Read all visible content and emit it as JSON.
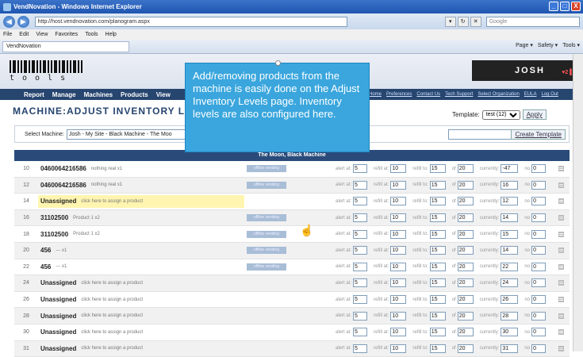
{
  "window": {
    "title": "VendNovation - Windows Internet Explorer",
    "controls": [
      "_",
      "□",
      "X"
    ]
  },
  "browser": {
    "url": "http://host.vendnovation.com/planogram.aspx",
    "search_placeholder": "Google",
    "menu": [
      "File",
      "Edit",
      "View",
      "Favorites",
      "Tools",
      "Help"
    ],
    "tab_label": "VendNovation",
    "toolbar": [
      "Page ▾",
      "Safety ▾",
      "Tools ▾"
    ]
  },
  "site": {
    "logo_text": "tools",
    "user": "JOSH",
    "badge": "♥2 ▌18",
    "nav": [
      "Report",
      "Manage",
      "Machines",
      "Products",
      "View"
    ],
    "top_links": [
      "Home",
      "Preferences",
      "Contact Us",
      "Tech Support",
      "Select Organization",
      "EULA",
      "Log Out"
    ]
  },
  "page": {
    "title": "MACHINE:ADJUST INVENTORY LEVE",
    "template_label": "Template:",
    "template_value": "test (12)",
    "apply_label": "Apply",
    "select_machine_label": "Select Machine:",
    "machine_value": "Josh - My Site - Black Machine - The Moo",
    "create_template_label": "Create Template",
    "table_title": "The Moon, Black Machine"
  },
  "field_labels": {
    "alert": "alert at:",
    "refill": "refill at:",
    "refill_to": "refill to:",
    "of": "of",
    "currently": "currently:",
    "no": "no"
  },
  "rows": [
    {
      "num": "10",
      "code": "0460064216586",
      "note": "nothing real x1",
      "offline": "offline vending",
      "alert": "5",
      "refill": "10",
      "refill_to": "15",
      "of": "20",
      "currently": "-47",
      "no": "0"
    },
    {
      "num": "12",
      "code": "0460064216586",
      "note": "nothing real x1",
      "offline": "offline vending",
      "alert": "5",
      "refill": "10",
      "refill_to": "15",
      "of": "20",
      "currently": "16",
      "no": "0"
    },
    {
      "num": "14",
      "code": "Unassigned",
      "note": "click here to assign a product",
      "offline": "",
      "alert": "5",
      "refill": "10",
      "refill_to": "15",
      "of": "20",
      "currently": "12",
      "no": "0",
      "highlight": true
    },
    {
      "num": "16",
      "code": "31102500",
      "note": "Product 1 x2",
      "offline": "offline vending",
      "alert": "5",
      "refill": "10",
      "refill_to": "15",
      "of": "20",
      "currently": "14",
      "no": "0"
    },
    {
      "num": "18",
      "code": "31102500",
      "note": "Product 1 x2",
      "offline": "offline vending",
      "alert": "5",
      "refill": "10",
      "refill_to": "15",
      "of": "20",
      "currently": "15",
      "no": "0"
    },
    {
      "num": "20",
      "code": "456",
      "note": "--- x1",
      "offline": "offline vending",
      "alert": "5",
      "refill": "10",
      "refill_to": "15",
      "of": "20",
      "currently": "14",
      "no": "0"
    },
    {
      "num": "22",
      "code": "456",
      "note": "--- x1",
      "offline": "offline vending",
      "alert": "5",
      "refill": "10",
      "refill_to": "15",
      "of": "20",
      "currently": "22",
      "no": "0"
    },
    {
      "num": "24",
      "code": "Unassigned",
      "note": "click here to assign a product",
      "offline": "",
      "alert": "5",
      "refill": "10",
      "refill_to": "15",
      "of": "20",
      "currently": "24",
      "no": "0"
    },
    {
      "num": "26",
      "code": "Unassigned",
      "note": "click here to assign a product",
      "offline": "",
      "alert": "5",
      "refill": "10",
      "refill_to": "15",
      "of": "20",
      "currently": "26",
      "no": "0"
    },
    {
      "num": "28",
      "code": "Unassigned",
      "note": "click here to assign a product",
      "offline": "",
      "alert": "5",
      "refill": "10",
      "refill_to": "15",
      "of": "20",
      "currently": "28",
      "no": "0"
    },
    {
      "num": "30",
      "code": "Unassigned",
      "note": "click here to assign a product",
      "offline": "",
      "alert": "5",
      "refill": "10",
      "refill_to": "15",
      "of": "20",
      "currently": "30",
      "no": "0"
    },
    {
      "num": "31",
      "code": "Unassigned",
      "note": "click here to assign a product",
      "offline": "",
      "alert": "5",
      "refill": "10",
      "refill_to": "15",
      "of": "20",
      "currently": "31",
      "no": "0"
    }
  ],
  "callout": {
    "text": "Add/removing products from the machine is easily done on the Adjust Inventory Levels page. Inventory levels are also configured here."
  },
  "colors": {
    "nav_bg": "#26456f",
    "callout_bg": "#3aa6dd",
    "highlight_row": "#fff5b0",
    "offline_badge": "#a8bdd6"
  }
}
